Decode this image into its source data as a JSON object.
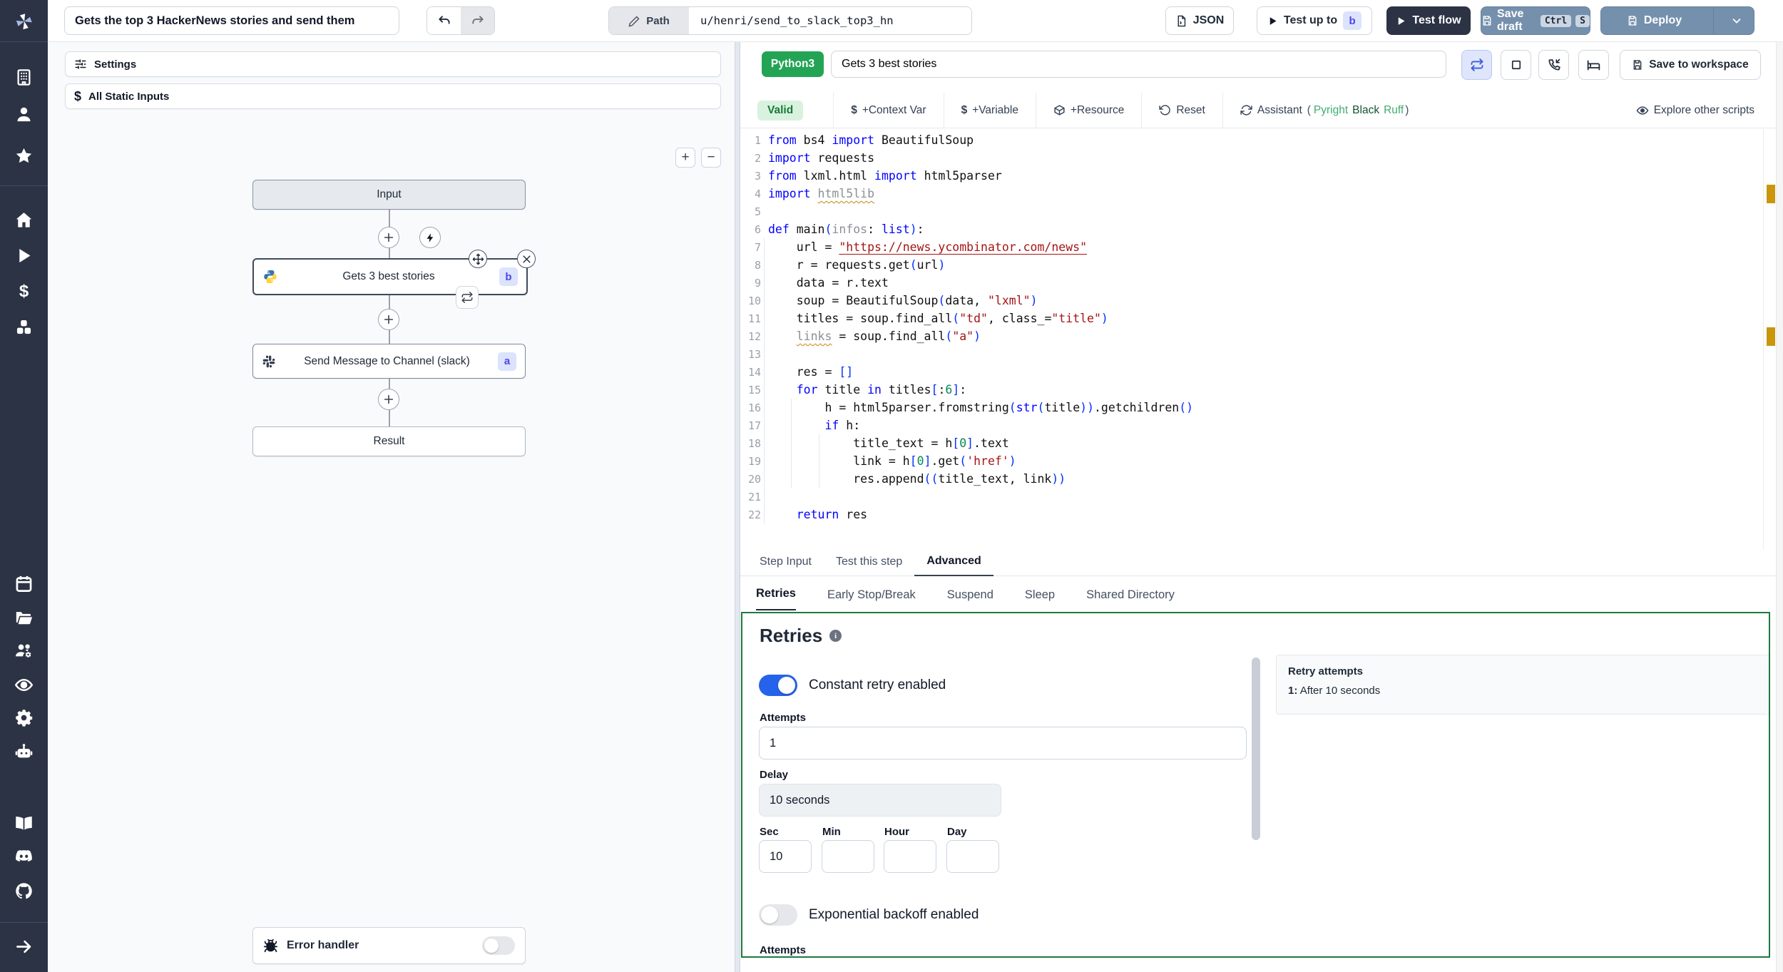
{
  "header": {
    "flow_title": "Gets the top 3 HackerNews stories and send them",
    "path_label": "Path",
    "path_value": "u/henri/send_to_slack_top3_hn",
    "json_label": "JSON",
    "test_up_to_label": "Test up to",
    "test_up_to_badge": "b",
    "test_flow_label": "Test flow",
    "save_draft_label": "Save draft",
    "kbd_ctrl": "Ctrl",
    "kbd_s": "S",
    "deploy_label": "Deploy"
  },
  "flow_panel": {
    "settings_label": "Settings",
    "static_inputs_label": "All Static Inputs",
    "zoom_in": "+",
    "zoom_out": "−",
    "nodes": {
      "input": "Input",
      "step1_label": "Gets 3 best stories",
      "step1_badge": "b",
      "step2_label": "Send Message to Channel (slack)",
      "step2_badge": "a",
      "result": "Result"
    },
    "error_handler_label": "Error handler",
    "error_handler_enabled": false
  },
  "editor": {
    "language": "Python3",
    "step_name": "Gets 3 best stories",
    "save_to_workspace": "Save to workspace",
    "toolbar": {
      "valid": "Valid",
      "context_var": "+Context Var",
      "variable": "+Variable",
      "resource": "+Resource",
      "reset": "Reset",
      "assistant": "Assistant",
      "assistant_open": "(",
      "linter_pyright": "Pyright",
      "linter_black": "Black",
      "linter_ruff": "Ruff",
      "assistant_close": ")",
      "explore": "Explore other scripts"
    },
    "code": {
      "warning_lines": [
        4,
        12
      ],
      "lines": [
        [
          [
            "from",
            "k"
          ],
          [
            " bs4 ",
            "d"
          ],
          [
            "import",
            "k"
          ],
          [
            " BeautifulSoup",
            "d"
          ]
        ],
        [
          [
            "import",
            "k"
          ],
          [
            " requests",
            "d"
          ]
        ],
        [
          [
            "from",
            "k"
          ],
          [
            " lxml.html ",
            "d"
          ],
          [
            "import",
            "k"
          ],
          [
            " html5parser",
            "d"
          ]
        ],
        [
          [
            "import",
            "k"
          ],
          [
            " ",
            "d"
          ],
          [
            "html5lib",
            "gw"
          ]
        ],
        [],
        [
          [
            "def",
            "k"
          ],
          [
            " main",
            "d"
          ],
          [
            "(",
            "p"
          ],
          [
            "infos",
            "g"
          ],
          [
            ": ",
            "d"
          ],
          [
            "list",
            "k"
          ],
          [
            ")",
            "p"
          ],
          [
            ":",
            "d"
          ]
        ],
        [
          [
            "    url = ",
            "d"
          ],
          [
            "\"https://news.ycombinator.com/news\"",
            "sl"
          ]
        ],
        [
          [
            "    r = requests.get",
            "d"
          ],
          [
            "(",
            "p"
          ],
          [
            "url",
            "d"
          ],
          [
            ")",
            "p"
          ]
        ],
        [
          [
            "    data = r.text",
            "d"
          ]
        ],
        [
          [
            "    soup = BeautifulSoup",
            "d"
          ],
          [
            "(",
            "p"
          ],
          [
            "data, ",
            "d"
          ],
          [
            "\"lxml\"",
            "s"
          ],
          [
            ")",
            "p"
          ]
        ],
        [
          [
            "    titles = soup.find_all",
            "d"
          ],
          [
            "(",
            "p"
          ],
          [
            "\"td\"",
            "s"
          ],
          [
            ", class_=",
            "d"
          ],
          [
            "\"title\"",
            "s"
          ],
          [
            ")",
            "p"
          ]
        ],
        [
          [
            "    ",
            "d"
          ],
          [
            "links",
            "gw"
          ],
          [
            " = soup.find_all",
            "d"
          ],
          [
            "(",
            "p"
          ],
          [
            "\"a\"",
            "s"
          ],
          [
            ")",
            "p"
          ]
        ],
        [],
        [
          [
            "    res = ",
            "d"
          ],
          [
            "[]",
            "p"
          ]
        ],
        [
          [
            "    ",
            "d"
          ],
          [
            "for",
            "k"
          ],
          [
            " title ",
            "d"
          ],
          [
            "in",
            "k"
          ],
          [
            " titles",
            "d"
          ],
          [
            "[",
            "p"
          ],
          [
            ":",
            "d"
          ],
          [
            "6",
            "n"
          ],
          [
            "]",
            "p"
          ],
          [
            ":",
            "d"
          ]
        ],
        [
          [
            "        h = html5parser.fromstring",
            "d"
          ],
          [
            "(",
            "p"
          ],
          [
            "str",
            "k"
          ],
          [
            "(",
            "p"
          ],
          [
            "title",
            "d"
          ],
          [
            ")",
            "p"
          ],
          [
            ")",
            "p"
          ],
          [
            ".getchildren",
            "d"
          ],
          [
            "()",
            "p"
          ]
        ],
        [
          [
            "        ",
            "d"
          ],
          [
            "if",
            "k"
          ],
          [
            " h:",
            "d"
          ]
        ],
        [
          [
            "            title_text = h",
            "d"
          ],
          [
            "[",
            "p"
          ],
          [
            "0",
            "n"
          ],
          [
            "]",
            "p"
          ],
          [
            ".text",
            "d"
          ]
        ],
        [
          [
            "            link = h",
            "d"
          ],
          [
            "[",
            "p"
          ],
          [
            "0",
            "n"
          ],
          [
            "]",
            "p"
          ],
          [
            ".get",
            "d"
          ],
          [
            "(",
            "p"
          ],
          [
            "'href'",
            "s"
          ],
          [
            ")",
            "p"
          ]
        ],
        [
          [
            "            res.append",
            "d"
          ],
          [
            "((",
            "p"
          ],
          [
            "title_text, link",
            "d"
          ],
          [
            "))",
            "p"
          ]
        ],
        [],
        [
          [
            "    ",
            "d"
          ],
          [
            "return",
            "k"
          ],
          [
            " res",
            "d"
          ]
        ]
      ]
    }
  },
  "panel_tabs": {
    "step_input": "Step Input",
    "test_this_step": "Test this step",
    "advanced": "Advanced",
    "active": "Advanced"
  },
  "advanced_tabs": {
    "retries": "Retries",
    "early_stop": "Early Stop/Break",
    "suspend": "Suspend",
    "sleep": "Sleep",
    "shared_directory": "Shared Directory",
    "active": "Retries"
  },
  "retries": {
    "title": "Retries",
    "constant_retry_label": "Constant retry enabled",
    "constant_retry_enabled": true,
    "attempts_label": "Attempts",
    "attempts_value": "1",
    "delay_label": "Delay",
    "delay_value": "10 seconds",
    "sec_label": "Sec",
    "sec_value": "10",
    "min_label": "Min",
    "min_value": "",
    "hour_label": "Hour",
    "hour_value": "",
    "day_label": "Day",
    "day_value": "",
    "exponential_label": "Exponential backoff enabled",
    "exponential_enabled": false,
    "attempts2_label": "Attempts",
    "summary": {
      "title": "Retry attempts",
      "item_index": "1:",
      "item_text": "After 10 seconds"
    }
  },
  "icons": [
    "windmill-logo",
    "building",
    "user",
    "star",
    "home",
    "play",
    "dollar",
    "boxes",
    "calendar",
    "folder-open",
    "users-cog",
    "eye",
    "gear",
    "robot",
    "book-open",
    "discord",
    "github",
    "arrow-right",
    "pencil",
    "file-json",
    "undo",
    "redo",
    "save",
    "chevron-down",
    "sliders",
    "python",
    "slack",
    "bug",
    "plus-connector",
    "lightning",
    "move",
    "close",
    "repeat",
    "square-stop",
    "phone-incoming",
    "bed",
    "package",
    "reset-arrow",
    "refresh",
    "info"
  ],
  "colors": {
    "sidebar_bg": "#2c3345",
    "accent_blue": "#2563eb",
    "steel_button": "#7590ad",
    "dark_button": "#2c3345",
    "green_badge": "#23a455",
    "valid_bg": "#d9f2df",
    "valid_text": "#187a38",
    "panel_border_green": "#1d7a3f",
    "warning_marker": "#c9960c",
    "badge_indigo_bg": "#dbe3fd",
    "badge_indigo_text": "#4f46e5"
  }
}
